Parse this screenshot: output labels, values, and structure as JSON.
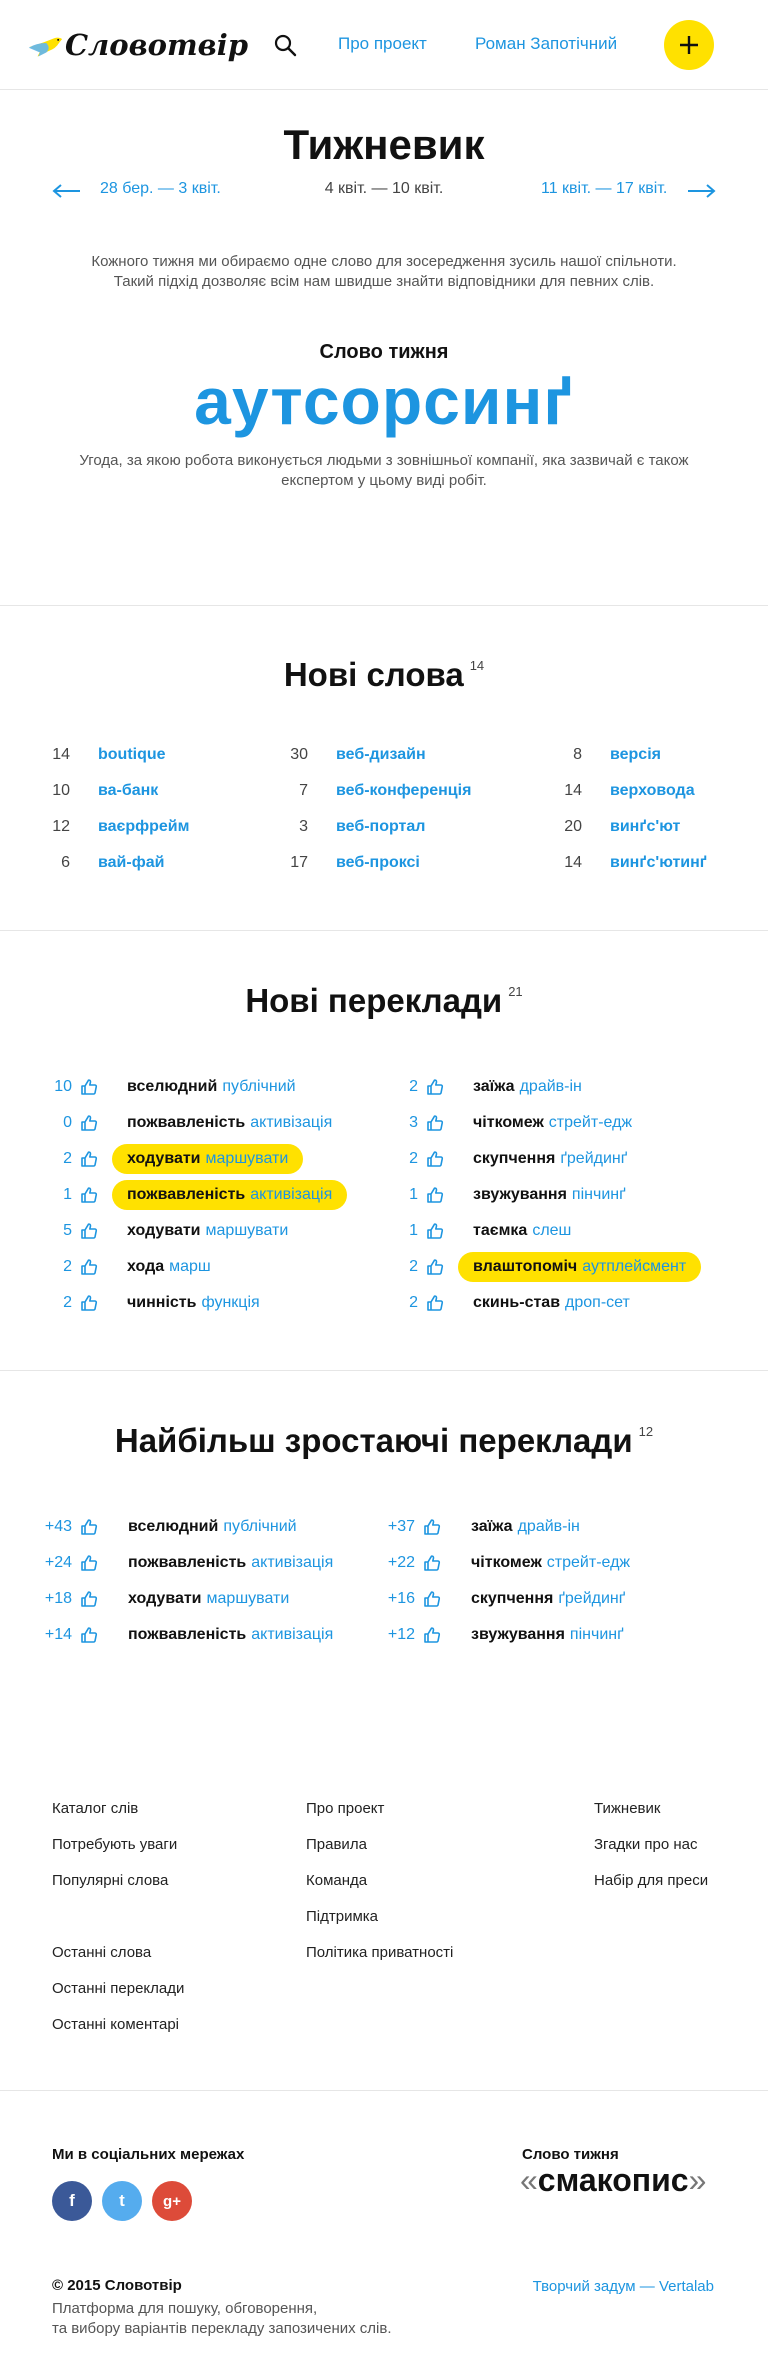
{
  "header": {
    "logo_text": "Словотвір",
    "nav": [
      "Про проект",
      "Роман Запотічний"
    ]
  },
  "weekly": {
    "title": "Тижневик",
    "prev": "28 бер. — 3 квіт.",
    "current": "4 квіт. — 10 квіт.",
    "next": "11 квіт. — 17 квіт.",
    "intro_1": "Кожного тижня ми обираємо одне слово для зосередження зусиль нашої спільноти.",
    "intro_2": "Такий підхід дозволяє всім нам швидше знайти відповідники для певних слів.",
    "word_label": "Слово тижня",
    "word": "аутсорсинґ",
    "definition_1": "Угода, за якою робота виконується людьми з зовнішньої компанії, яка зазвичай є також",
    "definition_2": "експертом у цьому виді робіт."
  },
  "new_words": {
    "title": "Нові слова",
    "count": "14",
    "items": [
      {
        "count": "14",
        "word": "boutique"
      },
      {
        "count": "10",
        "word": "ва-банк"
      },
      {
        "count": "12",
        "word": "ваєрфрейм"
      },
      {
        "count": "6",
        "word": "вай-фай"
      },
      {
        "count": "30",
        "word": "веб-дизайн"
      },
      {
        "count": "7",
        "word": "веб-конференція"
      },
      {
        "count": "3",
        "word": "веб-портал"
      },
      {
        "count": "17",
        "word": "веб-проксі"
      },
      {
        "count": "8",
        "word": "версія"
      },
      {
        "count": "14",
        "word": "верховода"
      },
      {
        "count": "20",
        "word": "винґс'ют"
      },
      {
        "count": "14",
        "word": "винґс'ютинґ"
      }
    ]
  },
  "new_translations": {
    "title": "Нові переклади",
    "count": "21",
    "items": [
      {
        "count": "10",
        "ua": "вселюдний",
        "en": "публічний",
        "hl": false
      },
      {
        "count": "0",
        "ua": "пожвавленість",
        "en": "активізація",
        "hl": false
      },
      {
        "count": "2",
        "ua": "ходувати",
        "en": "маршувати",
        "hl": true
      },
      {
        "count": "1",
        "ua": "пожвавленість",
        "en": "активізація",
        "hl": true
      },
      {
        "count": "5",
        "ua": "ходувати",
        "en": "маршувати",
        "hl": false
      },
      {
        "count": "2",
        "ua": "хода",
        "en": "марш",
        "hl": false
      },
      {
        "count": "2",
        "ua": "чинність",
        "en": "функція",
        "hl": false
      },
      {
        "count": "2",
        "ua": "заїжа",
        "en": "драйв-ін",
        "hl": false
      },
      {
        "count": "3",
        "ua": "чіткомеж",
        "en": "стрейт-едж",
        "hl": false
      },
      {
        "count": "2",
        "ua": "скупчення",
        "en": "ґрейдинґ",
        "hl": false
      },
      {
        "count": "1",
        "ua": "звужування",
        "en": "пінчинґ",
        "hl": false
      },
      {
        "count": "1",
        "ua": "таємка",
        "en": "слеш",
        "hl": false
      },
      {
        "count": "2",
        "ua": "влаштопоміч",
        "en": "аутплейсмент",
        "hl": true
      },
      {
        "count": "2",
        "ua": "скинь-став",
        "en": "дроп-сет",
        "hl": false
      }
    ]
  },
  "trending": {
    "title": "Найбільш зростаючі переклади",
    "count": "12",
    "items": [
      {
        "count": "+43",
        "ua": "вселюдний",
        "en": "публічний"
      },
      {
        "count": "+24",
        "ua": "пожвавленість",
        "en": "активізація"
      },
      {
        "count": "+18",
        "ua": "ходувати",
        "en": "маршувати"
      },
      {
        "count": "+14",
        "ua": "пожвавленість",
        "en": "активізація"
      },
      {
        "count": "+37",
        "ua": "заїжа",
        "en": "драйв-ін"
      },
      {
        "count": "+22",
        "ua": "чіткомеж",
        "en": "стрейт-едж"
      },
      {
        "count": "+16",
        "ua": "скупчення",
        "en": "ґрейдинґ"
      },
      {
        "count": "+12",
        "ua": "звужування",
        "en": "пінчинґ"
      }
    ]
  },
  "footer": {
    "col1": [
      "Каталог слів",
      "Потребують уваги",
      "Популярні слова",
      "Останні слова",
      "Останні переклади",
      "Останні коментарі"
    ],
    "col2": [
      "Про проект",
      "Правила",
      "Команда",
      "Підтримка",
      "Політика приватності"
    ],
    "col3": [
      "Тижневик",
      "Згадки про нас",
      "Набір для преси"
    ],
    "social_title": "Ми в соціальних мережах",
    "social": [
      "f",
      "t",
      "g+"
    ],
    "wotw_label": "Слово тижня",
    "wotw_word": "смакопис",
    "copyright": "© 2015 Словотвір",
    "tagline_1": "Платформа для пошуку, обговорення,",
    "tagline_2": "та вибору варіантів перекладу запозичених слів.",
    "credit": "Творчий задум — Vertalab"
  },
  "colors": {
    "accent": "#1d95e0",
    "highlight": "#ffe100",
    "facebook": "#3b5998",
    "twitter": "#55acee",
    "google": "#dd4b39"
  }
}
